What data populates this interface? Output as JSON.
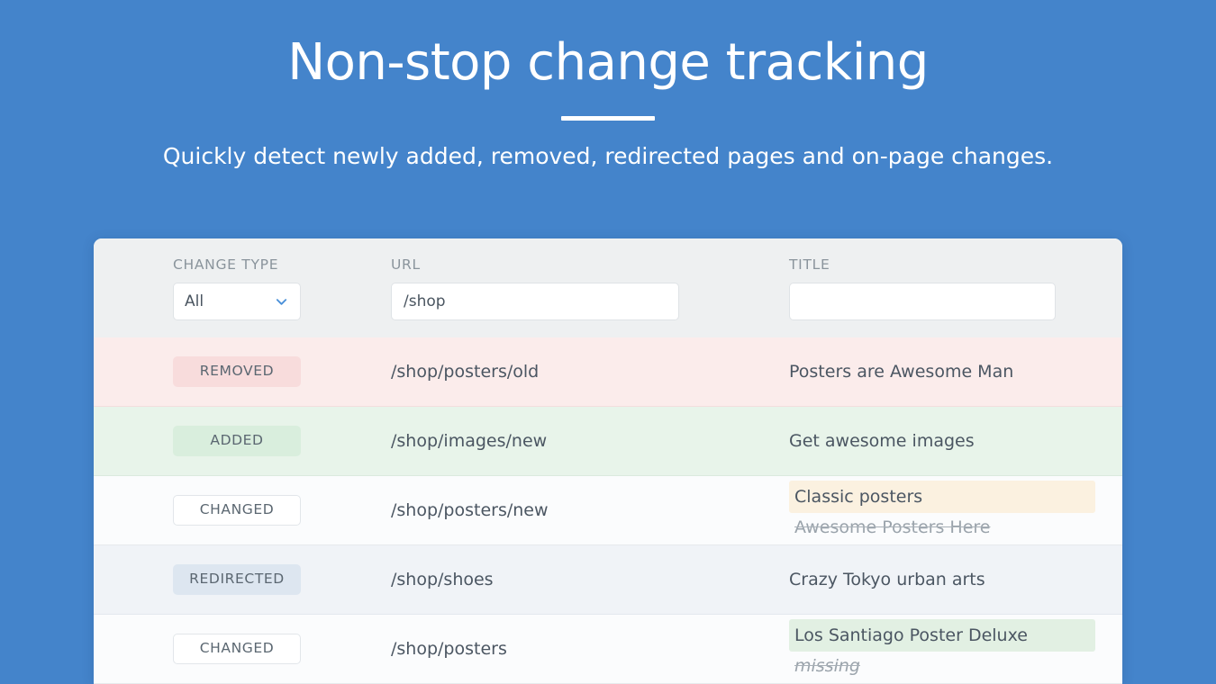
{
  "hero": {
    "title": "Non-stop change tracking",
    "subtitle": "Quickly detect newly added, removed, redirected pages and on-page changes."
  },
  "colors": {
    "background_blue": "#4484cb",
    "header_grey": "#eef0f1",
    "row_removed": "#fbeceb",
    "row_added": "#e8f4ea",
    "row_changed": "#fbfcfd",
    "row_redirected": "#f0f3f7",
    "badge_removed": "#f8dcdc",
    "badge_added": "#d9eedd",
    "badge_redirected": "#dde6f0",
    "highlight_cream": "#fbf1e0",
    "highlight_green": "#e2f0e3",
    "accent_blue": "#4a90d9"
  },
  "filters": {
    "change_type": {
      "label": "CHANGE TYPE",
      "selected": "All",
      "options": [
        "All"
      ],
      "icon": "chevron-down-icon"
    },
    "url": {
      "label": "URL",
      "value": "/shop",
      "placeholder": ""
    },
    "title": {
      "label": "TITLE",
      "value": "",
      "placeholder": ""
    }
  },
  "table": {
    "rows": [
      {
        "change_type": "REMOVED",
        "url": "/shop/posters/old",
        "title_new": "Posters are Awesome Man",
        "title_old": null,
        "highlight": null
      },
      {
        "change_type": "ADDED",
        "url": "/shop/images/new",
        "title_new": "Get awesome images",
        "title_old": null,
        "highlight": null
      },
      {
        "change_type": "CHANGED",
        "url": "/shop/posters/new",
        "title_new": "Classic posters",
        "title_old": "Awesome Posters Here",
        "highlight": "cream"
      },
      {
        "change_type": "REDIRECTED",
        "url": "/shop/shoes",
        "title_new": "Crazy Tokyo urban arts",
        "title_old": null,
        "highlight": null
      },
      {
        "change_type": "CHANGED",
        "url": "/shop/posters",
        "title_new": "Los Santiago Poster Deluxe",
        "title_old": "missing",
        "highlight": "green"
      }
    ]
  }
}
